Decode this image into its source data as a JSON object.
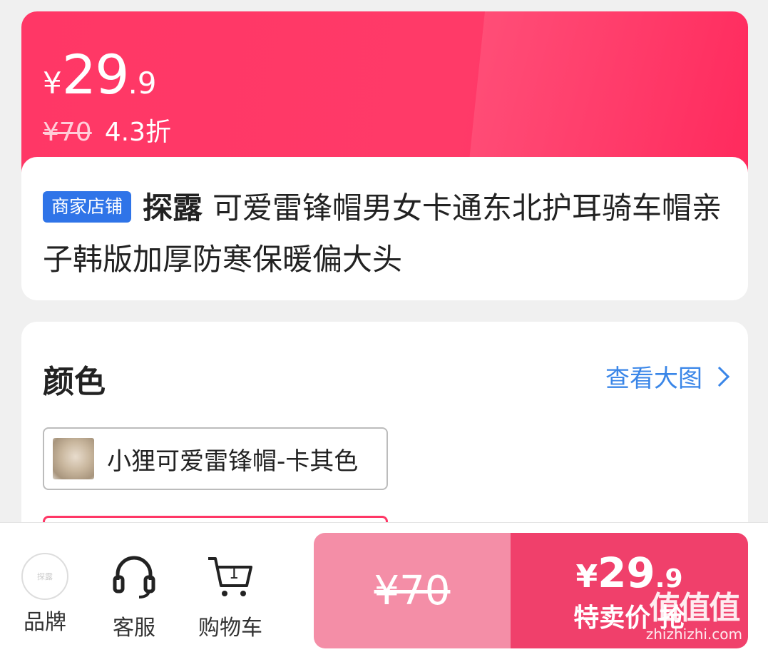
{
  "price": {
    "currency": "¥",
    "integer": "29",
    "decimal": ".9",
    "original": "¥70",
    "discount": "4.3折"
  },
  "product": {
    "shop_badge": "商家店铺",
    "brand": "探露",
    "title": "可爱雷锋帽男女卡通东北护耳骑车帽亲子韩版加厚防寒保暖偏大头"
  },
  "color_section": {
    "title": "颜色",
    "view_large": "查看大图",
    "options": [
      "小狸可爱雷锋帽-卡其色"
    ]
  },
  "bottom_bar": {
    "brand_icon_text": "探露",
    "brand_label": "品牌",
    "service_label": "客服",
    "cart_label": "购物车",
    "cart_count": "1",
    "orig_price": "¥70",
    "special_currency": "¥",
    "special_integer": "29",
    "special_decimal": ".9",
    "special_label": "特卖价 抢"
  },
  "watermark": {
    "big": "值值值",
    "small": "zhizhizhi.com"
  },
  "colors": {
    "accent": "#ff3766",
    "link": "#3a86e8",
    "badge": "#2f74e8"
  }
}
